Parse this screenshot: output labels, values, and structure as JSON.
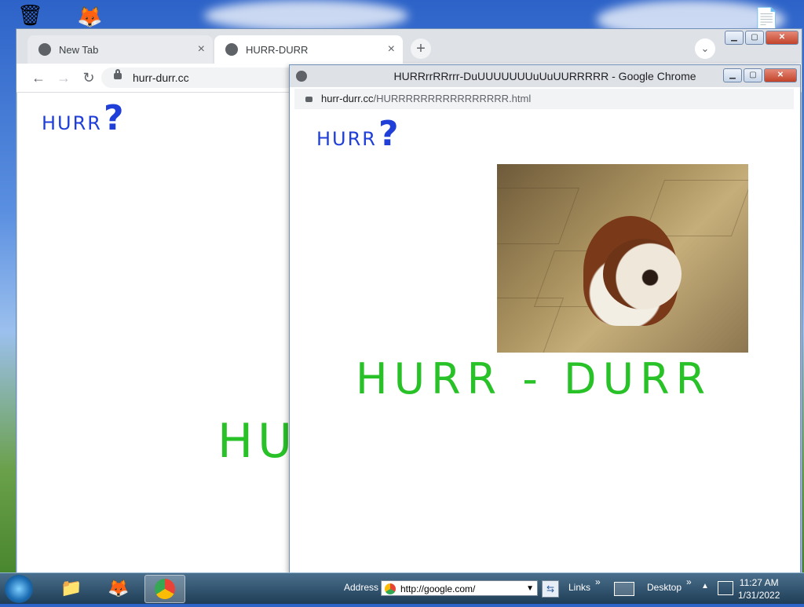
{
  "main_window": {
    "tabs": [
      {
        "label": "New Tab",
        "close": "×"
      },
      {
        "label": "HURR-DURR",
        "close": "×"
      }
    ],
    "new_tab": "+",
    "url": "hurr-durr.cc",
    "page": {
      "hurr": "HURR",
      "q": "?",
      "big_text": "HU"
    }
  },
  "popup_window": {
    "title": "HURRrrRRrrr-DuUUUUUUUuUuUURRRRR - Google Chrome",
    "url_host": "hurr-durr.cc",
    "url_path": "/HURRRRRRRRRRRRRRRR.html",
    "page": {
      "hurr": "HURR",
      "q": "?",
      "big_text": "HURR - DURR"
    }
  },
  "taskbar": {
    "address_label": "Address",
    "address_value": "http://google.com/",
    "links": "Links",
    "desktop": "Desktop",
    "chevron": "»",
    "time": "11:27 AM",
    "date": "1/31/2022"
  }
}
